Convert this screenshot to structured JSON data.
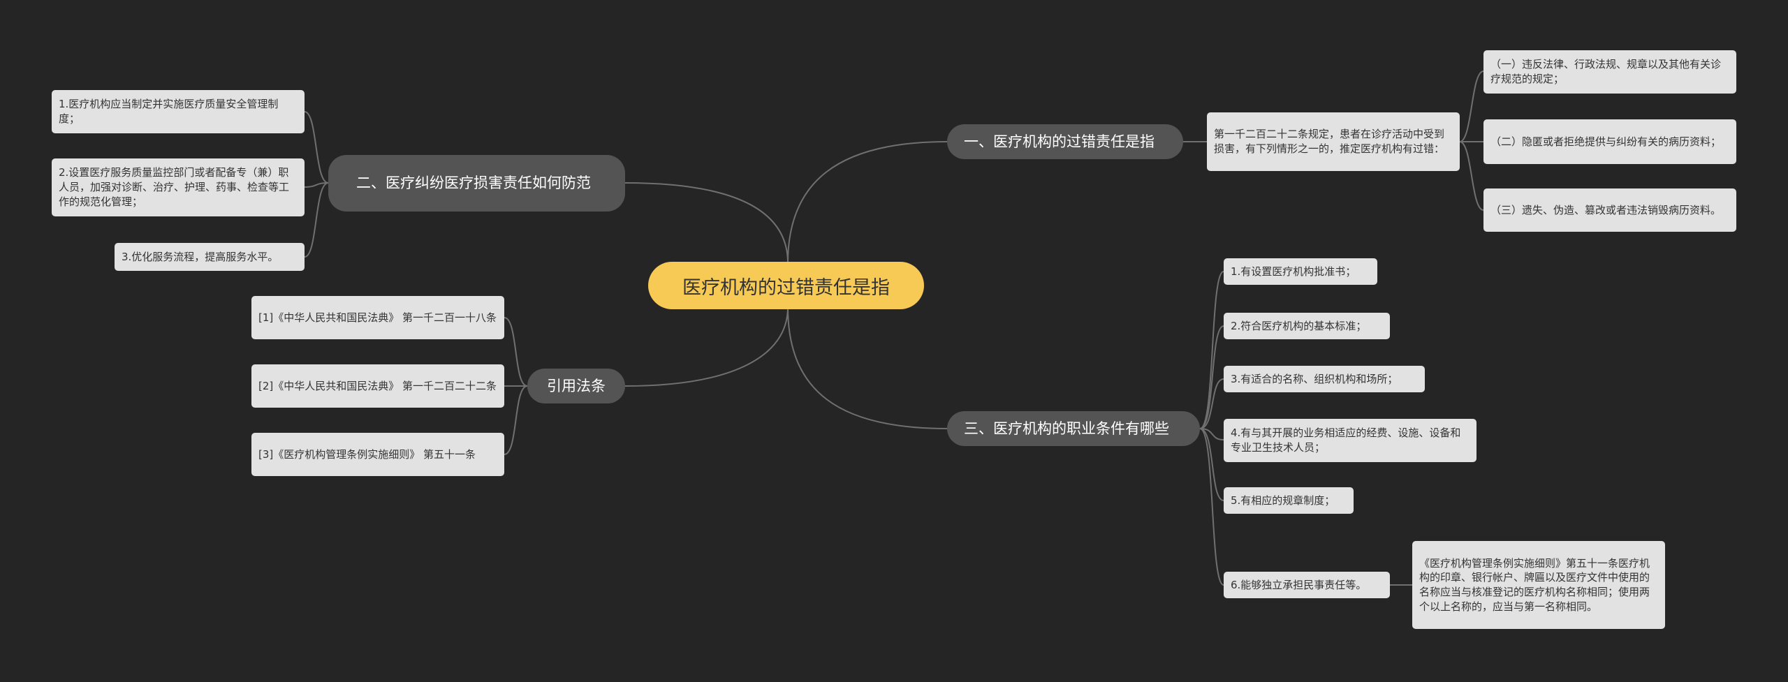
{
  "root": {
    "label": "医疗机构的过错责任是指"
  },
  "branch1": {
    "label": "一、医疗机构的过错责任是指",
    "description": "第一千二百二十二条规定，患者在诊疗活动中受到损害，有下列情形之一的，推定医疗机构有过错：",
    "items": [
      "（一）违反法律、行政法规、规章以及其他有关诊疗规范的规定；",
      "（二）隐匿或者拒绝提供与纠纷有关的病历资料；",
      "（三）遗失、伪造、篡改或者违法销毁病历资料。"
    ]
  },
  "branch2": {
    "label": "二、医疗纠纷医疗损害责任如何防范",
    "items": [
      "1.医疗机构应当制定并实施医疗质量安全管理制度；",
      "2.设置医疗服务质量监控部门或者配备专（兼）职人员，加强对诊断、治疗、护理、药事、检查等工作的规范化管理；",
      "3.优化服务流程，提高服务水平。"
    ]
  },
  "branch3": {
    "label": "三、医疗机构的职业条件有哪些",
    "items": [
      "1.有设置医疗机构批准书；",
      "2.符合医疗机构的基本标准；",
      "3.有适合的名称、组织机构和场所；",
      "4.有与其开展的业务相适应的经费、设施、设备和专业卫生技术人员；",
      "5.有相应的规章制度；",
      "6.能够独立承担民事责任等。"
    ],
    "item6_note": "《医疗机构管理条例实施细则》第五十一条医疗机构的印章、银行帐户、牌匾以及医疗文件中使用的名称应当与核准登记的医疗机构名称相同；使用两个以上名称的，应当与第一名称相同。"
  },
  "references": {
    "label": "引用法条",
    "items": [
      "[1]《中华人民共和国民法典》 第一千二百一十八条",
      "[2]《中华人民共和国民法典》 第一千二百二十二条",
      "[3]《医疗机构管理条例实施细则》 第五十一条"
    ]
  },
  "colors": {
    "background": "#252525",
    "root_fill": "#f7c955",
    "branch_fill": "#545454",
    "leaf_fill": "#e2e2e2",
    "connector": "#707070"
  }
}
